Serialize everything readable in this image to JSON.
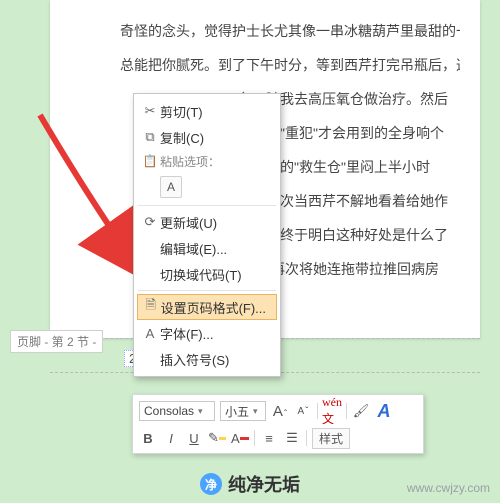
{
  "document": {
    "lines": [
      "奇怪的念头，觉得护士长尤其像一串冰糖葫芦里最甜的一颗",
      "总能把你腻死。到了下午时分，等到西芹打完吊瓶后，这颗糖",
      "备，随我去高压氧仓做治疗。然后",
      "有押送\"重犯\"才会用到的全身响个",
      "钻进去的\"救生仓\"里闷上半小时",
      "，有一次当西芹不解地看着给她作",
      "，西芹终于明白这种好处是什么了",
      "轮椅\"再次将她连拖带拉推回病房"
    ]
  },
  "footer": {
    "label": "页脚 - 第 2 节 -",
    "page_number": "2"
  },
  "context_menu": {
    "cut": "剪切(T)",
    "copy": "复制(C)",
    "paste_header": "粘贴选项：",
    "paste_opt": "A",
    "update_field": "更新域(U)",
    "edit_field": "编辑域(E)...",
    "toggle_codes": "切换域代码(T)",
    "page_number_format": "设置页码格式(F)...",
    "font": "字体(F)...",
    "insert_symbol": "插入符号(S)"
  },
  "mini_toolbar": {
    "font_name": "Consolas",
    "font_size": "小五",
    "bold": "B",
    "italic": "I",
    "underline": "U",
    "styles": "样式"
  },
  "watermark": {
    "text": "纯净无垢",
    "url": "www.cwjzy.com"
  }
}
